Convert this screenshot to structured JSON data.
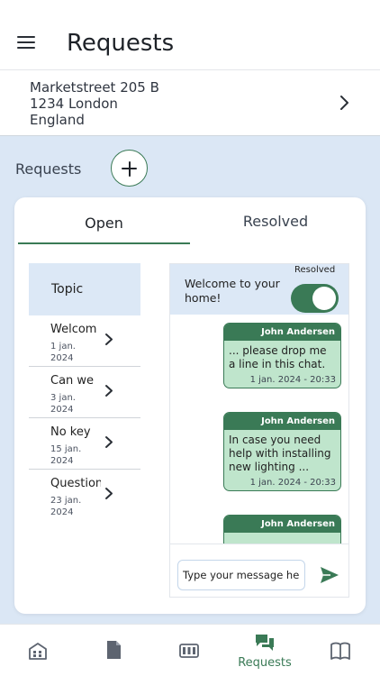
{
  "header": {
    "title": "Requests",
    "menu_icon": "hamburger-menu-icon"
  },
  "address": {
    "line1": "Marketstreet 205 B",
    "line2": "1234 London",
    "line3": "England",
    "chevron_icon": "chevron-right-icon"
  },
  "requests_section": {
    "label": "Requests",
    "add_icon": "plus-icon"
  },
  "tabs": [
    {
      "label": "Open",
      "active": true
    },
    {
      "label": "Resolved",
      "active": false
    }
  ],
  "topics": {
    "header": "Topic",
    "rows": [
      {
        "title": "Welcom",
        "date": "1 jan. 2024"
      },
      {
        "title": "Can we",
        "date": "3 jan. 2024"
      },
      {
        "title": "No key",
        "date": "15 jan. 2024"
      },
      {
        "title": "Question",
        "date": "23 jan. 2024"
      }
    ]
  },
  "chat": {
    "topic_title": "Welcome to your home!",
    "resolved_label": "Resolved",
    "resolved_toggle": true,
    "messages": [
      {
        "author": "John Andersen",
        "text": "... please drop me a line in this chat.",
        "time": "1 jan. 2024 - 20:33"
      },
      {
        "author": "John Andersen",
        "text": "In case you need help with installing new lighting ...",
        "time": "1 jan. 2024 - 20:33"
      },
      {
        "author": "John Andersen",
        "text": "",
        "time": ""
      }
    ],
    "input_placeholder": "Type your message her...",
    "send_icon": "send-icon"
  },
  "bottom_nav": [
    {
      "icon": "home-icon",
      "label": ""
    },
    {
      "icon": "document-icon",
      "label": ""
    },
    {
      "icon": "meter-icon",
      "label": ""
    },
    {
      "icon": "chat-bubbles-icon",
      "label": "Requests",
      "active": true
    },
    {
      "icon": "book-icon",
      "label": ""
    }
  ],
  "colors": {
    "accent": "#3a7a56",
    "bubble": "#bfe5cc",
    "panel": "#dce8f6",
    "background": "#dbe7f5"
  }
}
